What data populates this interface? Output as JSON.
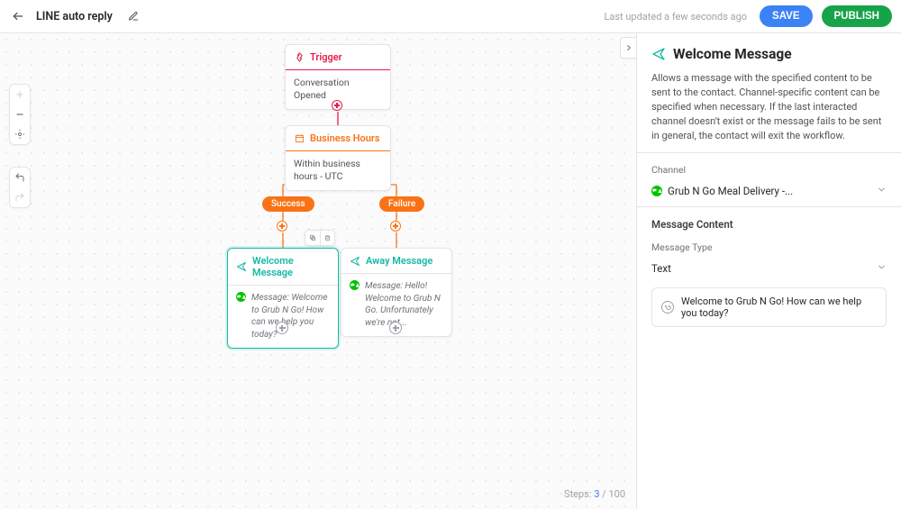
{
  "header": {
    "title": "LINE auto reply",
    "last_updated": "Last updated a few seconds ago",
    "save_label": "SAVE",
    "publish_label": "PUBLISH"
  },
  "canvas": {
    "steps_label": "Steps:",
    "steps_current": "3",
    "steps_max": "100",
    "nodes": {
      "trigger": {
        "title": "Trigger",
        "body": "Conversation Opened"
      },
      "business_hours": {
        "title": "Business Hours",
        "body": "Within business hours - UTC"
      },
      "welcome": {
        "title": "Welcome Message",
        "prefix": "Message:",
        "text": "Welcome to Grub N Go! How can we help  you today?"
      },
      "away": {
        "title": "Away Message",
        "prefix": "Message:",
        "text": "Hello! Welcome to Grub N Go. Unfortunately we're not..."
      }
    },
    "chips": {
      "success": "Success",
      "failure": "Failure"
    }
  },
  "panel": {
    "title": "Welcome Message",
    "description": "Allows a message with the specified content to be sent to the contact. Channel-specific content can be specified when necessary. If the last interacted channel doesn't exist or the message fails to be sent in general, the contact will exit the workflow.",
    "channel_label": "Channel",
    "channel_value": "Grub N Go Meal Delivery -...",
    "message_content_label": "Message Content",
    "message_type_label": "Message Type",
    "message_type_value": "Text",
    "preview_text": "Welcome to Grub N Go! How can we help you today?"
  },
  "colors": {
    "orange": "#f97316",
    "pink": "#e11d48",
    "teal": "#14b8a6",
    "blue": "#3b82f6",
    "green": "#16a34a",
    "line_green": "#00c300"
  }
}
